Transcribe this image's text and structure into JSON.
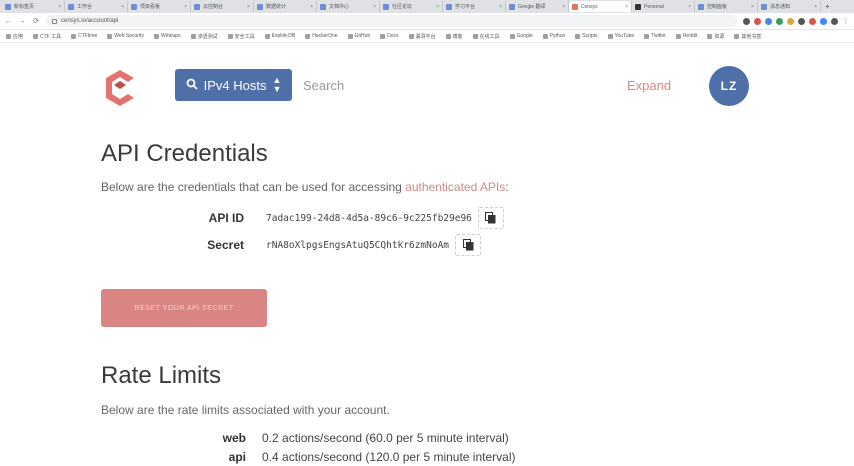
{
  "browser": {
    "tabs": [
      {
        "title": "新标签页"
      },
      {
        "title": "工作台"
      },
      {
        "title": "项目看板"
      },
      {
        "title": "云控制台"
      },
      {
        "title": "数据统计"
      },
      {
        "title": "文档中心"
      },
      {
        "title": "社区论坛"
      },
      {
        "title": "学习平台"
      },
      {
        "title": "Google 翻译"
      },
      {
        "title": "Censys"
      },
      {
        "title": "Personal"
      },
      {
        "title": "控制面板"
      },
      {
        "title": "消息通知"
      }
    ],
    "url": "censys.io/account/api",
    "bookmarks": [
      "应用",
      "CTF 工具",
      "CTFtime",
      "Web Security",
      "Writeups",
      "渗透测试",
      "安全工具",
      "Exploit-DB",
      "HackerOne",
      "GitHub",
      "Docs",
      "漏洞平台",
      "博客",
      "在线工具",
      "Google",
      "Python",
      "Scripts",
      "YouTube",
      "Twitter",
      "Reddit",
      "资源",
      "其他书签"
    ]
  },
  "header": {
    "search_type": "IPv4 Hosts",
    "search_placeholder": "Search",
    "expand_label": "Expand",
    "avatar_initials": "LZ"
  },
  "credentials": {
    "title": "API Credentials",
    "intro_text": "Below are the credentials that can be used for accessing ",
    "intro_highlight": "authenticated APIs",
    "intro_end": ":",
    "api_id_label": "API ID",
    "api_id_value": "7adac199-24d8-4d5a-89c6-9c225fb29e96",
    "secret_label": "Secret",
    "secret_value": "rNA8oXlpgsEngsAtuQ5CQhtkr6zmNoAm",
    "reset_button": "RESET YOUR API SECRET"
  },
  "rate_limits": {
    "title": "Rate Limits",
    "intro_text": "Below are the rate limits associated with your account.",
    "rows": [
      {
        "label": "web",
        "value": "0.2 actions/second (60.0 per 5 minute interval)"
      },
      {
        "label": "api",
        "value": "0.4 actions/second (120.0 per 5 minute interval)"
      }
    ]
  }
}
